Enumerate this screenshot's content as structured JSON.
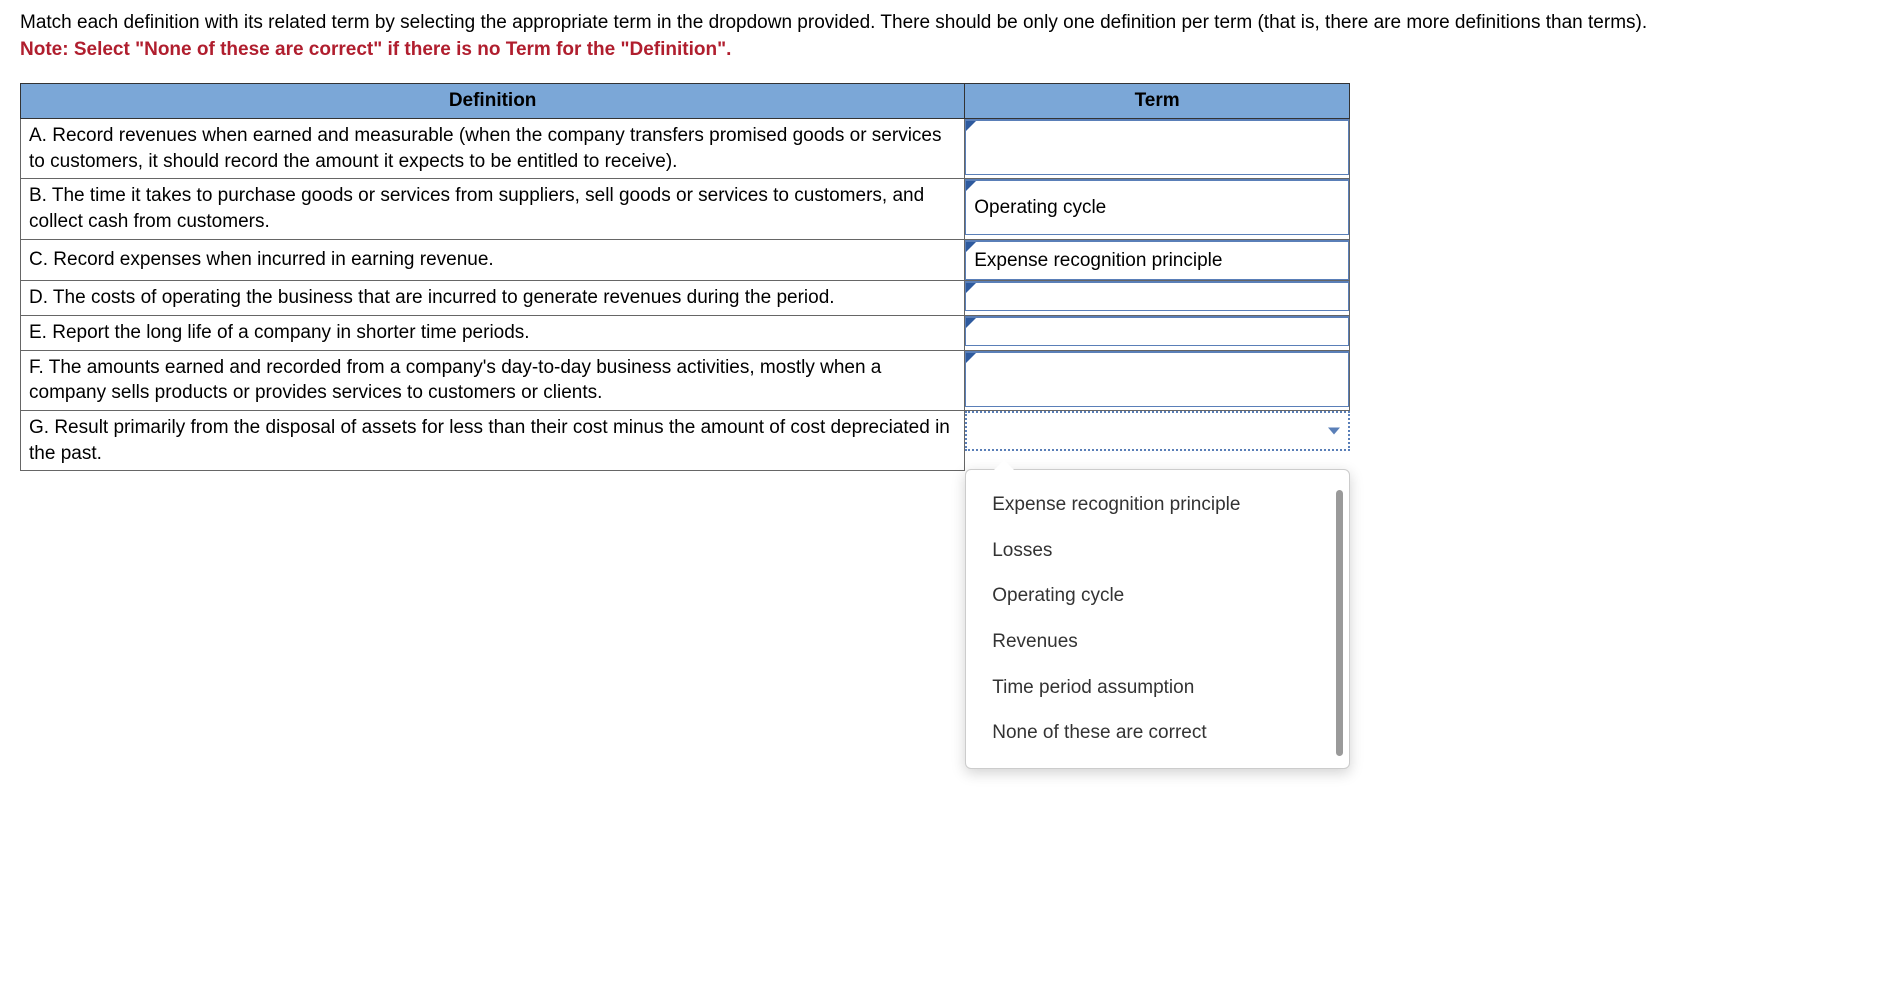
{
  "instructions": {
    "line1": "Match each definition with its related term by selecting the appropriate term in the dropdown provided. There should be only one definition per term (that is, there are more definitions than terms).",
    "note": "Note: Select \"None of these are correct\" if there is no Term for the \"Definition\"."
  },
  "headers": {
    "definition": "Definition",
    "term": "Term"
  },
  "rows": [
    {
      "definition": "A. Record revenues when earned and measurable (when the company transfers promised goods or services to customers, it should record the amount it expects to be entitled to receive).",
      "term": "",
      "tall": true
    },
    {
      "definition": "B. The time it takes to purchase goods or services from suppliers, sell goods or services to customers, and collect cash from customers.",
      "term": "Operating cycle",
      "tall": true
    },
    {
      "definition": "C. Record expenses when incurred in earning revenue.",
      "term": "Expense recognition principle",
      "tall": false
    },
    {
      "definition": "D. The costs of operating the business that are incurred to generate revenues during the period.",
      "term": "",
      "tall": false
    },
    {
      "definition": "E. Report the long life of a company in shorter time periods.",
      "term": "",
      "tall": false
    },
    {
      "definition": "F. The amounts earned and recorded from a company's day-to-day business activities, mostly when a company sells products or provides services to customers or clients.",
      "term": "",
      "tall": true
    },
    {
      "definition": "G. Result primarily from the disposal of assets for less than their cost minus the amount of cost depreciated in the past.",
      "term": "",
      "active": true
    }
  ],
  "dropdown_options": [
    "Expense recognition principle",
    "Losses",
    "Operating cycle",
    "Revenues",
    "Time period assumption",
    "None of these are correct"
  ]
}
